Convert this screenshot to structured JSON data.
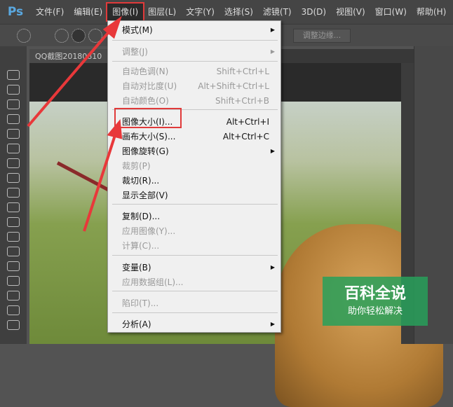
{
  "app": {
    "logo": "Ps"
  },
  "menubar": [
    "文件(F)",
    "编辑(E)",
    "图像(I)",
    "图层(L)",
    "文字(Y)",
    "选择(S)",
    "滤镜(T)",
    "3D(D)",
    "视图(V)",
    "窗口(W)",
    "帮助(H)"
  ],
  "toolbar": {
    "refine_edge": "调整边缘..."
  },
  "document": {
    "tab": "QQ截图20180810"
  },
  "menu": {
    "items": [
      {
        "label": "模式(M)",
        "shortcut": "",
        "submenu": true,
        "disabled": false
      },
      {
        "label": "调整(J)",
        "shortcut": "",
        "submenu": true,
        "disabled": true
      },
      {
        "label": "自动色调(N)",
        "shortcut": "Shift+Ctrl+L",
        "disabled": true
      },
      {
        "label": "自动对比度(U)",
        "shortcut": "Alt+Shift+Ctrl+L",
        "disabled": true
      },
      {
        "label": "自动颜色(O)",
        "shortcut": "Shift+Ctrl+B",
        "disabled": true
      },
      {
        "label": "图像大小(I)...",
        "shortcut": "Alt+Ctrl+I",
        "disabled": false
      },
      {
        "label": "画布大小(S)...",
        "shortcut": "Alt+Ctrl+C",
        "disabled": false
      },
      {
        "label": "图像旋转(G)",
        "shortcut": "",
        "submenu": true,
        "disabled": false
      },
      {
        "label": "裁剪(P)",
        "shortcut": "",
        "disabled": true
      },
      {
        "label": "裁切(R)...",
        "shortcut": "",
        "disabled": false
      },
      {
        "label": "显示全部(V)",
        "shortcut": "",
        "disabled": false
      },
      {
        "label": "复制(D)...",
        "shortcut": "",
        "disabled": false
      },
      {
        "label": "应用图像(Y)...",
        "shortcut": "",
        "disabled": true
      },
      {
        "label": "计算(C)...",
        "shortcut": "",
        "disabled": true
      },
      {
        "label": "变量(B)",
        "shortcut": "",
        "submenu": true,
        "disabled": false
      },
      {
        "label": "应用数据组(L)...",
        "shortcut": "",
        "disabled": true
      },
      {
        "label": "陷印(T)...",
        "shortcut": "",
        "disabled": true
      },
      {
        "label": "分析(A)",
        "shortcut": "",
        "submenu": true,
        "disabled": false
      }
    ]
  },
  "watermark": {
    "title": "百科全说",
    "subtitle": "助你轻松解决"
  },
  "colors": {
    "highlight": "#e03a3a"
  }
}
